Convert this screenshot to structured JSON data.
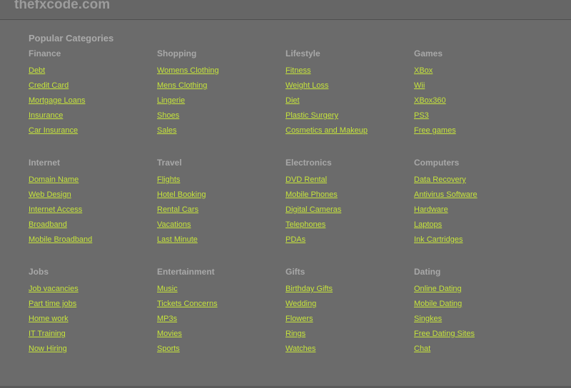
{
  "site": {
    "title": "thefxcode.com"
  },
  "popular": {
    "heading": "Popular Categories"
  },
  "groups": [
    {
      "title": "Finance",
      "links": [
        "Debt",
        "Credit Card",
        "Mortgage Loans",
        "Insurance",
        "Car Insurance"
      ]
    },
    {
      "title": "Shopping",
      "links": [
        "Womens Clothing",
        "Mens Clothing",
        "Lingerie",
        "Shoes",
        "Sales"
      ]
    },
    {
      "title": "Lifestyle",
      "links": [
        "Fitness",
        "Weight Loss",
        "Diet",
        "Plastic Surgery",
        "Cosmetics and Makeup"
      ]
    },
    {
      "title": "Games",
      "links": [
        "XBox",
        "Wii",
        "XBox360",
        "PS3",
        "Free games"
      ]
    },
    {
      "title": "Internet",
      "links": [
        "Domain Name",
        "Web Design",
        "Internet Access",
        "Broadband",
        "Mobile Broadband"
      ]
    },
    {
      "title": "Travel",
      "links": [
        "Flights",
        "Hotel Booking",
        "Rental Cars",
        "Vacations",
        "Last Minute"
      ]
    },
    {
      "title": "Electronics",
      "links": [
        "DVD Rental",
        "Mobile Phones",
        "Digital Cameras",
        "Telephones",
        "PDAs"
      ]
    },
    {
      "title": "Computers",
      "links": [
        "Data Recovery",
        "Antivirus Software",
        "Hardware",
        "Laptops",
        "Ink Cartridges"
      ]
    },
    {
      "title": "Jobs",
      "links": [
        "Job vacancies",
        "Part time jobs",
        "Home work",
        "IT Training",
        "Now Hiring"
      ]
    },
    {
      "title": "Entertainment",
      "links": [
        "Music",
        "Tickets Concerns",
        "MP3s",
        "Movies",
        "Sports"
      ]
    },
    {
      "title": "Gifts",
      "links": [
        "Birthday Gifts",
        "Wedding",
        "Flowers",
        "Rings",
        "Watches"
      ]
    },
    {
      "title": "Dating",
      "links": [
        "Online Dating",
        "Mobile Dating",
        "Singkes",
        "Free Dating Sites",
        "Chat"
      ]
    }
  ],
  "colors": {
    "background": "#6b6b6b",
    "link": "#c6e43b",
    "heading": "#a8a8a8",
    "site_title": "#9c9c9c"
  }
}
